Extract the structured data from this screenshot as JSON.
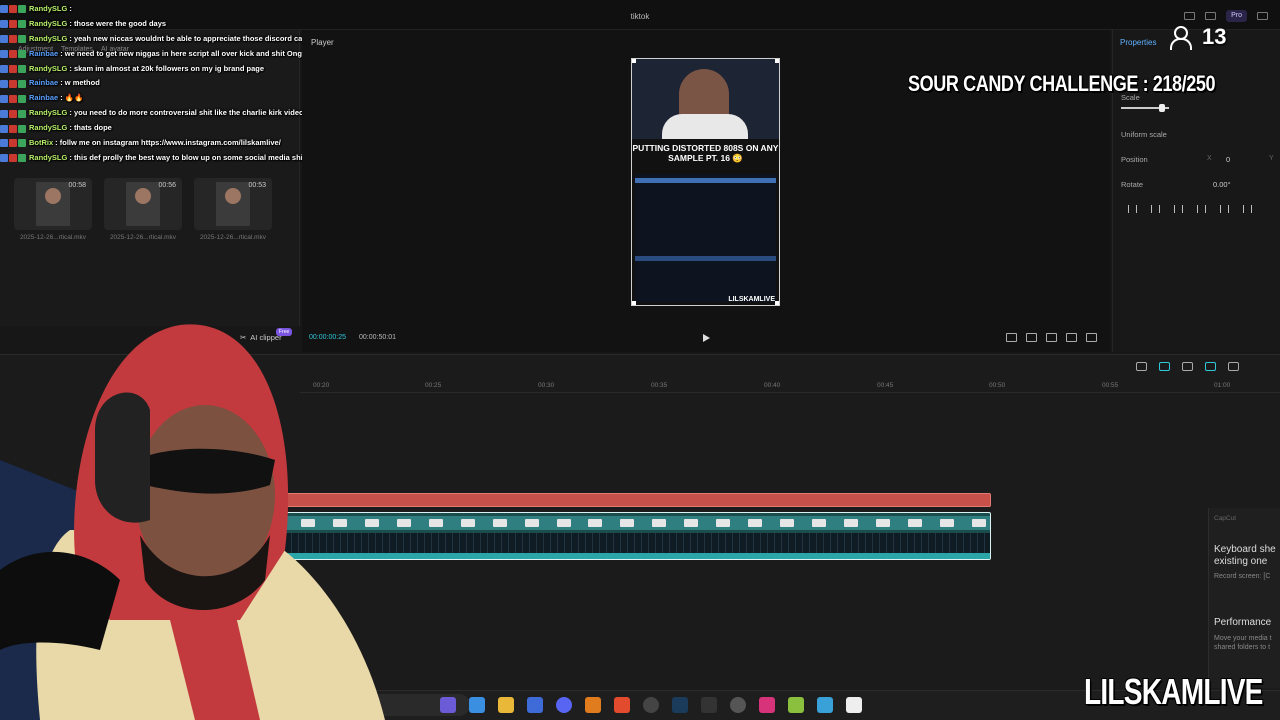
{
  "app": {
    "window_title": "tiktok",
    "pro_label": "Pro"
  },
  "media_panel": {
    "tabs": [
      "Adjustment",
      "Templates",
      "AI avatar"
    ],
    "items": [
      {
        "duration": "00:58",
        "name": "2025-12-26...rtical.mkv"
      },
      {
        "duration": "00:56",
        "name": "2025-12-26...rtical.mkv"
      },
      {
        "duration": "00:53",
        "name": "2025-12-26...rtical.mkv"
      }
    ],
    "ai_clipper_label": "AI clipper",
    "free_badge": "Free"
  },
  "chat": [
    {
      "user": "RandySLG",
      "color": "#b8f06a",
      "message": ""
    },
    {
      "user": "RandySLG",
      "color": "#b8f06a",
      "message": "those were the good days"
    },
    {
      "user": "RandySLG",
      "color": "#b8f06a",
      "message": "yeah new niccas wouldnt be able to appreciate those discord calls"
    },
    {
      "user": "Rainbae",
      "color": "#5aa0ff",
      "message": "we need to get new niggas in here script all over kick and shit Ong"
    },
    {
      "user": "RandySLG",
      "color": "#b8f06a",
      "message": "skam im almost at 20k followers on my ig brand page"
    },
    {
      "user": "Rainbae",
      "color": "#5aa0ff",
      "message": "w method"
    },
    {
      "user": "Rainbae",
      "color": "#5aa0ff",
      "message": "🔥🔥"
    },
    {
      "user": "RandySLG",
      "color": "#b8f06a",
      "message": "you need to do more controversial shit like the charlie kirk videos"
    },
    {
      "user": "RandySLG",
      "color": "#b8f06a",
      "message": "thats dope"
    },
    {
      "user": "BotRix",
      "color": "#b8f06a",
      "message": "follw me on instagram https://www.instagram.com/lilskamlive/"
    },
    {
      "user": "RandySLG",
      "color": "#b8f06a",
      "message": "this def prolly the best way to blow up on some social media shit"
    }
  ],
  "player": {
    "label": "Player",
    "video_caption": "PUTTING DISTORTED 808S ON ANY SAMPLE PT. 16 😳",
    "video_watermark": "LILSKAMLIVE",
    "current_time": "00:00:00:25",
    "total_time": "00:00:50:01"
  },
  "properties": {
    "title": "Properties",
    "scale_label": "Scale",
    "scale_value": 0.85,
    "uniform_scale_label": "Uniform scale",
    "position_label": "Position",
    "position_x_label": "X",
    "position_x_value": "0",
    "position_y_label": "Y",
    "rotate_label": "Rotate",
    "rotate_value": "0.00°"
  },
  "overlay": {
    "viewer_count": "13",
    "challenge_text": "SOUR CANDY CHALLENGE : 218/250",
    "watermark": "LILSKAMLIVE"
  },
  "timeline": {
    "ticks": [
      "00:20",
      "00:25",
      "00:30",
      "00:35",
      "00:40",
      "00:45",
      "00:50",
      "00:55",
      "01:00"
    ]
  },
  "notification": {
    "app": "CapCut",
    "title1": "Keyboard she",
    "sub1a": "existing one",
    "sub1b": "Record screen: [C",
    "title2": "Performance",
    "sub2a": "Move your media t",
    "sub2b": "shared folders to t"
  },
  "colors": {
    "accent": "#2ec8d8",
    "audio_track": "#c7514a",
    "video_track": "#1c4d4d",
    "hoodie": "#c23a3e"
  }
}
